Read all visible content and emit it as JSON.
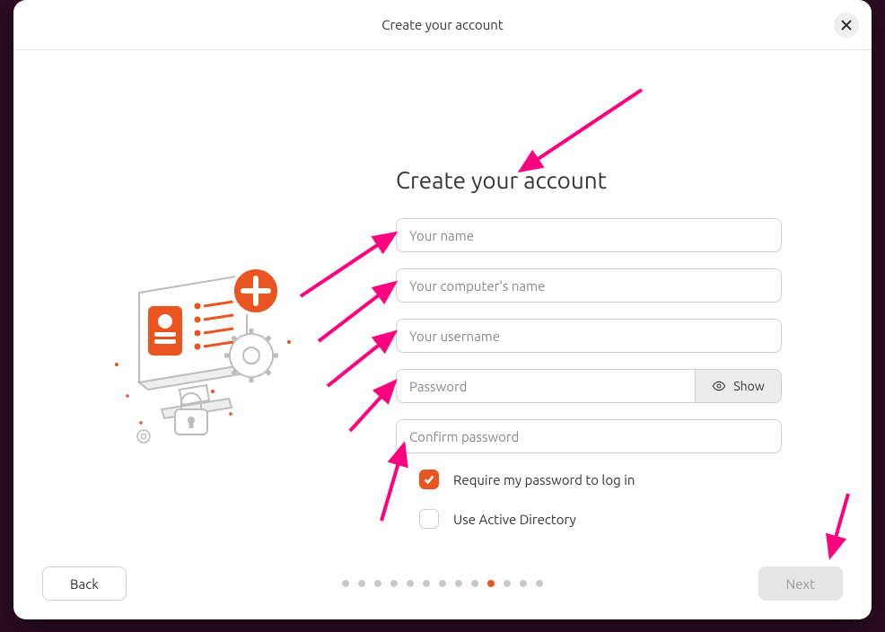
{
  "header": {
    "title": "Create your account"
  },
  "page": {
    "heading": "Create your account"
  },
  "fields": {
    "name_placeholder": "Your name",
    "computer_placeholder": "Your computer's name",
    "username_placeholder": "Your username",
    "password_placeholder": "Password",
    "confirm_placeholder": "Confirm password",
    "show_label": "Show"
  },
  "options": {
    "require_password_label": "Require my password to log in",
    "require_password_checked": true,
    "active_directory_label": "Use Active Directory",
    "active_directory_checked": false
  },
  "footer": {
    "back_label": "Back",
    "next_label": "Next",
    "step_total": 13,
    "step_active": 10
  },
  "colors": {
    "accent": "#E95420",
    "annotation": "#ff007f"
  }
}
